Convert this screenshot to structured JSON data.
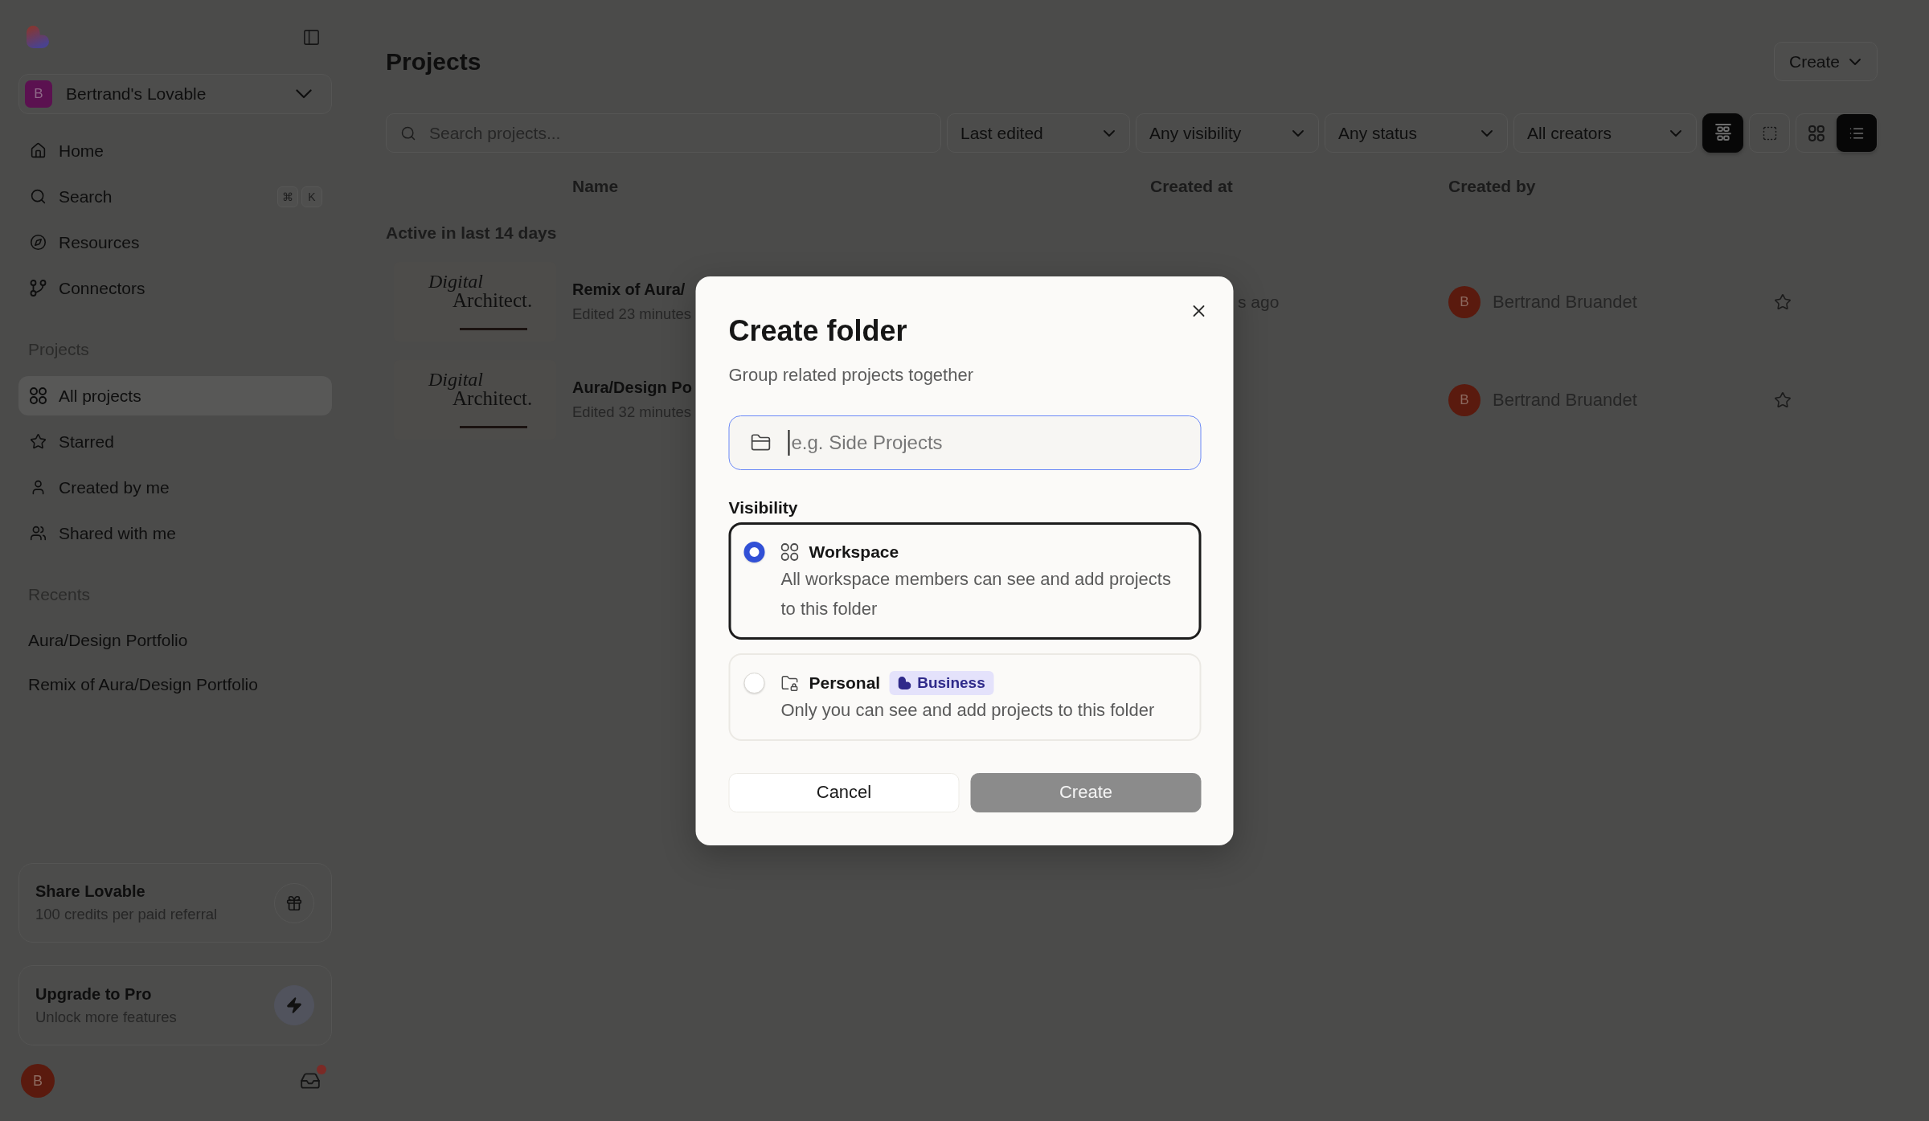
{
  "sidebar": {
    "workspace": {
      "initial": "B",
      "name": "Bertrand's Lovable"
    },
    "nav": [
      {
        "label": "Home",
        "selected": false
      },
      {
        "label": "Search",
        "selected": false,
        "shortcut": [
          "⌘",
          "K"
        ]
      },
      {
        "label": "Resources",
        "selected": false
      },
      {
        "label": "Connectors",
        "selected": false
      }
    ],
    "projects": {
      "label": "Projects",
      "items": [
        {
          "label": "All projects",
          "selected": true
        },
        {
          "label": "Starred",
          "selected": false
        },
        {
          "label": "Created by me",
          "selected": false
        },
        {
          "label": "Shared with me",
          "selected": false
        }
      ]
    },
    "recents": {
      "label": "Recents",
      "items": [
        {
          "label": "Aura/Design Portfolio"
        },
        {
          "label": "Remix of Aura/Design Portfolio"
        }
      ]
    },
    "share_card": {
      "title": "Share Lovable",
      "subtitle": "100 credits per paid referral"
    },
    "upgrade_card": {
      "title": "Upgrade to Pro",
      "subtitle": "Unlock more features"
    },
    "user": {
      "initial": "B",
      "unread": true
    }
  },
  "main": {
    "title": "Projects",
    "create_button": "Create",
    "search": {
      "placeholder": "Search projects..."
    },
    "filters": [
      "Last edited",
      "Any visibility",
      "Any status",
      "All creators"
    ],
    "view_toggles": [
      {
        "kind": "group",
        "selected": true
      },
      {
        "kind": "select",
        "selected": false
      }
    ],
    "view_modes": [
      {
        "kind": "grid",
        "selected": false
      },
      {
        "kind": "list",
        "selected": true
      }
    ],
    "table": {
      "columns": [
        "Name",
        "Created at",
        "Created by"
      ],
      "group_label": "Active in last 14 days",
      "rows": [
        {
          "thumbnail": {
            "line_1": "Digital",
            "line_2": "Architect."
          },
          "name": "Remix of Aura/",
          "edited": "Edited 23 minutes",
          "created_at": "s ago",
          "creator": {
            "initial": "B",
            "name": "Bertrand Bruandet"
          },
          "starred": false
        },
        {
          "thumbnail": {
            "line_1": "Digital",
            "line_2": "Architect."
          },
          "name": "Aura/Design Po",
          "edited": "Edited 32 minutes",
          "creator": {
            "initial": "B",
            "name": "Bertrand Bruandet"
          },
          "starred": false
        }
      ]
    }
  },
  "dialog": {
    "title": "Create folder",
    "subtitle": "Group related projects together",
    "input": {
      "placeholder": "e.g. Side Projects",
      "focused": true
    },
    "visibility_label": "Visibility",
    "options": [
      {
        "title": "Workspace",
        "description": "All workspace members can see and add projects to this folder",
        "selected": true
      },
      {
        "title": "Personal",
        "badge": "Business",
        "description": "Only you can see and add projects to this folder",
        "selected": false
      }
    ],
    "buttons": [
      {
        "label": "Cancel",
        "kind": "cancel",
        "disabled": false
      },
      {
        "label": "Create",
        "kind": "confirm",
        "disabled": true
      }
    ]
  }
}
